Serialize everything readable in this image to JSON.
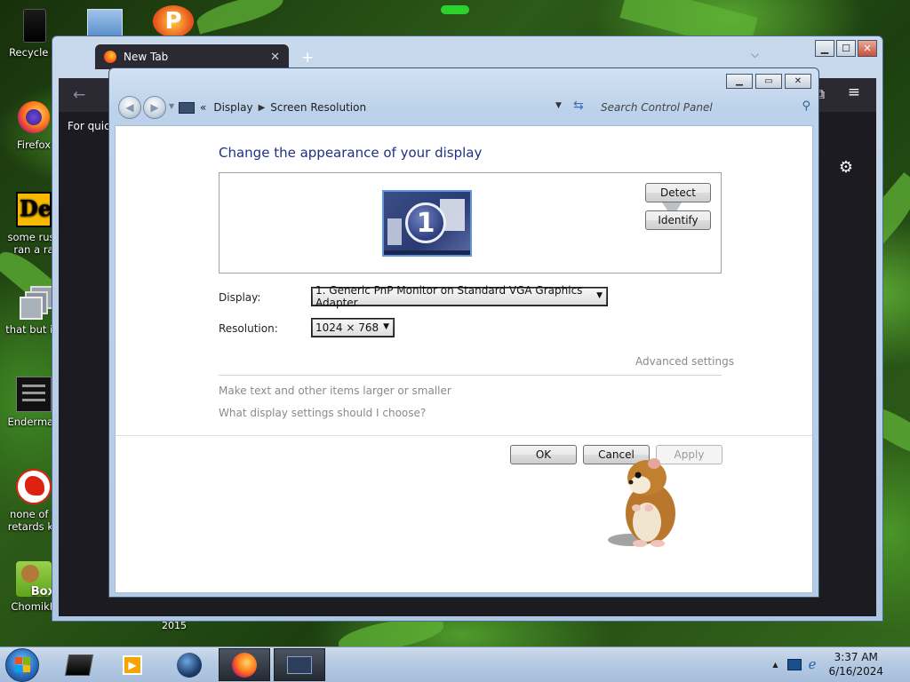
{
  "desktop": {
    "icons": [
      {
        "label": "Recycle B",
        "label2": ""
      },
      {
        "label": "Firefox",
        "label2": ""
      },
      {
        "label": "some russ",
        "label2": "ran a ra"
      },
      {
        "label": "that but its",
        "label2": ""
      },
      {
        "label": "Enderman",
        "label2": ""
      },
      {
        "label": "none of y",
        "label2": "retards kn"
      },
      {
        "label": "ChomikB",
        "label2": ""
      }
    ],
    "badge_de": "De",
    "badge_box": "Box",
    "year_label": "2015"
  },
  "browser": {
    "tab_title": "New Tab",
    "tab_close": "✕",
    "new_tab_glyph": "+",
    "quick_text": "For quick",
    "controls": {
      "minimize": "▁",
      "maximize": "☐",
      "close": "✕"
    }
  },
  "control_panel": {
    "breadcrumb": {
      "prefix": "«",
      "items": [
        "Display",
        "Screen Resolution"
      ],
      "separator": "▶"
    },
    "search_placeholder": "Search Control Panel",
    "title": "Change the appearance of your display",
    "monitor_number": "1",
    "buttons": {
      "detect": "Detect",
      "identify": "Identify",
      "ok": "OK",
      "cancel": "Cancel",
      "apply": "Apply"
    },
    "display_label": "Display:",
    "display_value": "1. Generic PnP Monitor on Standard VGA Graphics Adapter",
    "resolution_label": "Resolution:",
    "resolution_value": "1024 × 768",
    "advanced_link": "Advanced settings",
    "links": [
      "Make text and other items larger or smaller",
      "What display settings should I choose?"
    ],
    "controls": {
      "minimize": "▁",
      "maximize": "▭",
      "close": "✕"
    }
  },
  "taskbar": {
    "time": "3:37 AM",
    "date": "6/16/2024",
    "tray_arrow": "▲"
  },
  "icons": {
    "search": "search-icon",
    "refresh": "refresh-icon",
    "settings": "gear-icon",
    "menu": "hamburger-menu-icon"
  }
}
